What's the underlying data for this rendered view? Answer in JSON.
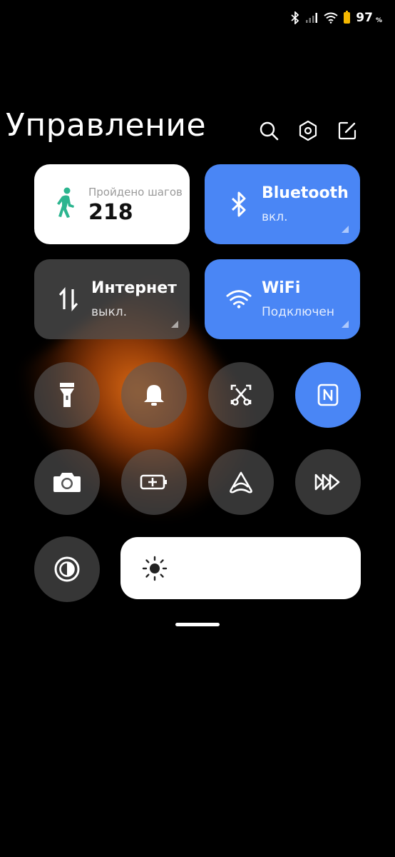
{
  "status": {
    "battery_percent": "97",
    "percent_sign": "%"
  },
  "header": {
    "title": "Управление"
  },
  "tiles": {
    "steps": {
      "label": "Пройдено шагов",
      "value": "218"
    },
    "bluetooth": {
      "name": "Bluetooth",
      "status": "вкл."
    },
    "internet": {
      "name": "Интернет",
      "status": "выкл."
    },
    "wifi": {
      "name": "WiFi",
      "status": "Подключен"
    }
  },
  "colors": {
    "accent": "#4a86f5",
    "step_icon": "#2bb58f",
    "battery": "#f5b800"
  },
  "toggles": [
    {
      "icon": "flashlight-icon",
      "active": false
    },
    {
      "icon": "bell-icon",
      "active": false
    },
    {
      "icon": "screenshot-icon",
      "active": false
    },
    {
      "icon": "nfc-icon",
      "active": true
    },
    {
      "icon": "camera-icon",
      "active": false
    },
    {
      "icon": "battery-saver-icon",
      "active": false
    },
    {
      "icon": "reading-mode-icon",
      "active": false
    },
    {
      "icon": "fast-forward-icon",
      "active": false
    },
    {
      "icon": "dark-mode-icon",
      "active": false
    }
  ],
  "brightness": {
    "level": 0.0
  }
}
